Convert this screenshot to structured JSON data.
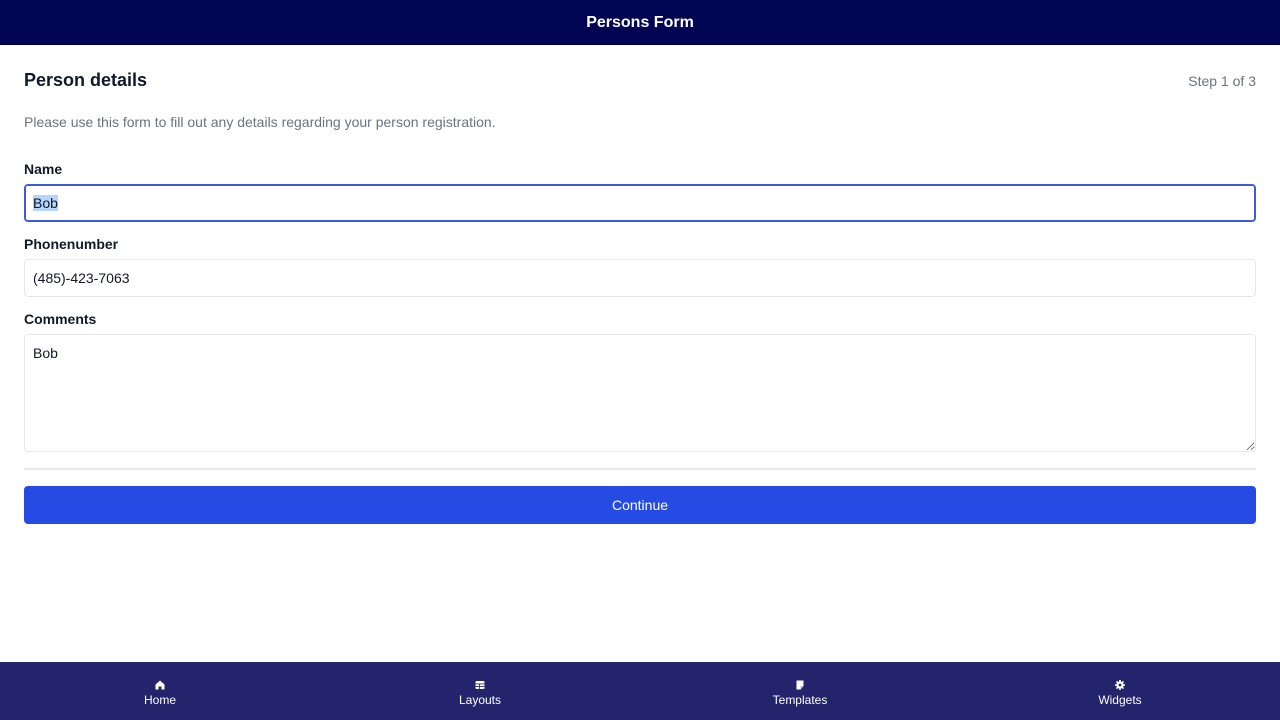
{
  "header": {
    "title": "Persons Form"
  },
  "form": {
    "title": "Person details",
    "step": "Step 1 of 3",
    "description": "Please use this form to fill out any details regarding your person registration.",
    "fields": {
      "name": {
        "label": "Name",
        "value": "Bob"
      },
      "phone": {
        "label": "Phonenumber",
        "value": "(485)-423-7063"
      },
      "comments": {
        "label": "Comments",
        "value": "Bob"
      }
    },
    "continue_label": "Continue"
  },
  "bottom_nav": {
    "items": [
      {
        "label": "Home",
        "icon": "home-icon"
      },
      {
        "label": "Layouts",
        "icon": "layouts-icon"
      },
      {
        "label": "Templates",
        "icon": "templates-icon"
      },
      {
        "label": "Widgets",
        "icon": "gear-icon"
      }
    ]
  },
  "colors": {
    "header_bg": "#000453",
    "nav_bg": "#23246b",
    "accent": "#264be4"
  }
}
